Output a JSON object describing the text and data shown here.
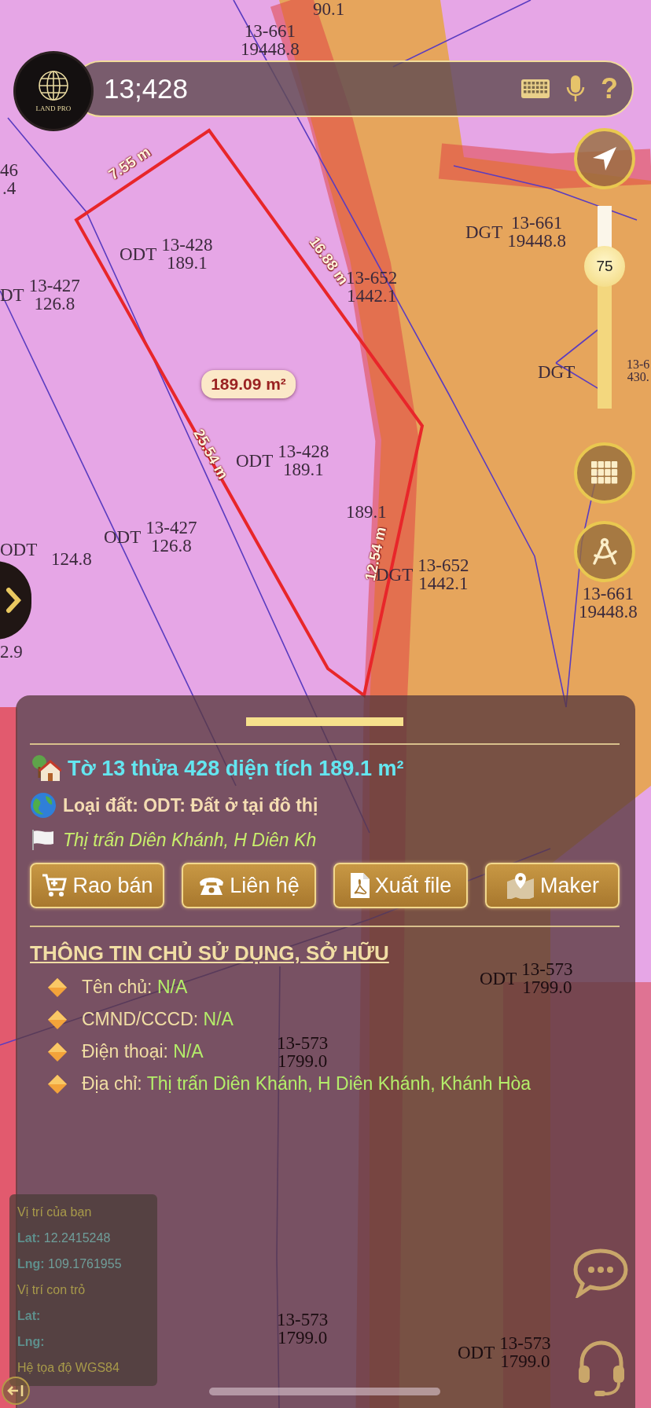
{
  "search": {
    "value": "13;428"
  },
  "logo": {
    "text": "LAND PRO"
  },
  "help_glyph": "?",
  "zoom_slider": {
    "level": 0.7,
    "reading": "75"
  },
  "map_labels": [
    {
      "lines": [
        "90.1"
      ]
    },
    {
      "lines": [
        "13-661",
        "19448.8"
      ]
    },
    {
      "lines": [
        "46",
        ".4"
      ]
    },
    {
      "code": "ODT",
      "lines": [
        "13-428",
        "189.1"
      ]
    },
    {
      "code": "DT",
      "lines": [
        "13-427",
        "126.8"
      ]
    },
    {
      "lines": [
        "13-652",
        "1442.1"
      ]
    },
    {
      "code": "DGT",
      "lines": [
        "13-661",
        "19448.8"
      ]
    },
    {
      "code": "DGT"
    },
    {
      "lines": [
        "13-6",
        "430."
      ]
    },
    {
      "code": "ODT",
      "lines": [
        "13-428",
        "189.1"
      ]
    },
    {
      "lines": [
        "189.1"
      ]
    },
    {
      "code": "ODT"
    },
    {
      "lines": [
        "124.8"
      ]
    },
    {
      "code": "ODT",
      "lines": [
        "13-427",
        "126.8"
      ]
    },
    {
      "code": "DGT",
      "lines": [
        "13-652",
        "1442.1"
      ]
    },
    {
      "lines": [
        "13-661",
        "19448.8"
      ]
    },
    {
      "lines": [
        "2.9"
      ]
    },
    {
      "code": "ODT",
      "lines": [
        "13-573",
        "1799.0"
      ]
    },
    {
      "lines": [
        "13-573",
        "1799.0"
      ]
    },
    {
      "lines": [
        "13-573",
        "1799.0"
      ]
    },
    {
      "code": "ODT",
      "lines": [
        "13-573",
        "1799.0"
      ]
    }
  ],
  "parcel": {
    "area": "189.09 m²",
    "edges": [
      "7.55 m",
      "16.88 m",
      "25.54 m",
      "12.54 m"
    ]
  },
  "panel": {
    "title": "Tờ 13 thửa 428 diện tích 189.1 m²",
    "land_type": "Loại đất: ODT: Đất ở tại đô thị",
    "location": "Thị trấn Diên Khánh, H Diên Kh",
    "buttons": [
      {
        "label": "Rao bán",
        "kind": "cart"
      },
      {
        "label": "Liên hệ",
        "kind": "phone"
      },
      {
        "label": "Xuất file",
        "kind": "pdf"
      },
      {
        "label": "Maker",
        "kind": "marker"
      }
    ],
    "owner_heading": "THÔNG TIN CHỦ SỬ DỤNG, SỞ HỮU",
    "owner_fields": [
      {
        "label": "Tên chủ:",
        "value": "N/A"
      },
      {
        "label": "CMND/CCCD:",
        "value": "N/A"
      },
      {
        "label": "Điện thoại:",
        "value": "N/A"
      },
      {
        "label": "Địa chỉ:",
        "value": "Thị trấn Diên Khánh, H Diên Khánh, Khánh Hòa"
      }
    ]
  },
  "coordinates": {
    "lines": [
      {
        "kind": "heading",
        "label": "Vị trí của bạn"
      },
      {
        "kind": "pair",
        "label": "Lat:",
        "value": "12.2415248"
      },
      {
        "kind": "pair",
        "label": "Lng:",
        "value": "109.1761955"
      },
      {
        "kind": "heading",
        "label": "Vị trí con trỏ"
      },
      {
        "kind": "pair",
        "label": "Lat:"
      },
      {
        "kind": "pair",
        "label": "Lng:"
      },
      {
        "kind": "heading",
        "label": "Hệ tọa độ WGS84"
      }
    ]
  }
}
